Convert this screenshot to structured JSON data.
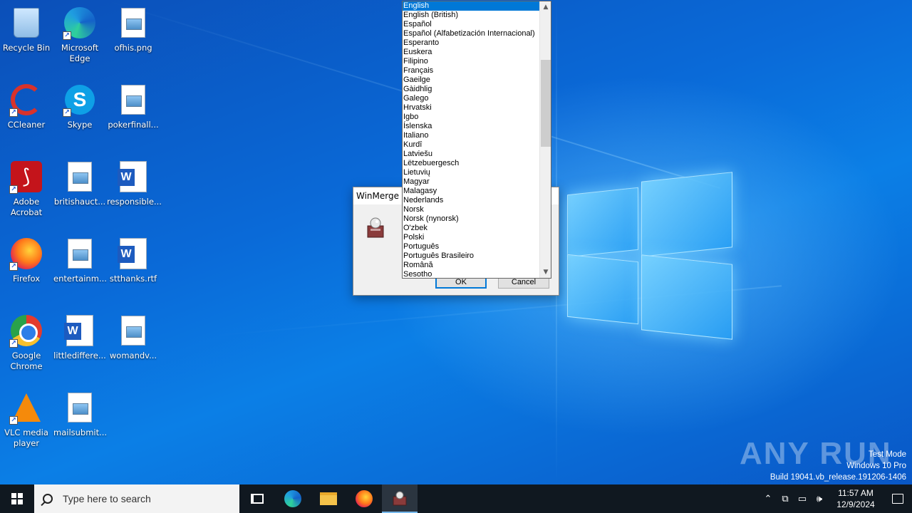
{
  "desktop": {
    "icons": [
      {
        "label": "Recycle Bin",
        "icon": "recycle-bin-icon"
      },
      {
        "label": "Microsoft Edge",
        "icon": "edge-icon"
      },
      {
        "label": "ofhis.png",
        "icon": "image-file-icon"
      },
      {
        "label": "CCleaner",
        "icon": "ccleaner-icon"
      },
      {
        "label": "Skype",
        "icon": "skype-icon"
      },
      {
        "label": "pokerfinall...",
        "icon": "image-file-icon"
      },
      {
        "label": "Adobe Acrobat",
        "icon": "acrobat-icon"
      },
      {
        "label": "britishauct...",
        "icon": "image-file-icon"
      },
      {
        "label": "responsible...",
        "icon": "word-file-icon"
      },
      {
        "label": "Firefox",
        "icon": "firefox-icon"
      },
      {
        "label": "entertainm...",
        "icon": "image-file-icon"
      },
      {
        "label": "stthanks.rtf",
        "icon": "word-file-icon"
      },
      {
        "label": "Google Chrome",
        "icon": "chrome-icon"
      },
      {
        "label": "littlediffere...",
        "icon": "word-file-icon"
      },
      {
        "label": "womandv...",
        "icon": "image-file-icon"
      },
      {
        "label": "VLC media player",
        "icon": "vlc-icon"
      },
      {
        "label": "mailsubmit...",
        "icon": "image-file-icon"
      }
    ]
  },
  "dialog": {
    "title": "WinMerge P",
    "ok_label": "OK",
    "cancel_label": "Cancel"
  },
  "language_list": {
    "selected": "English",
    "items": [
      "English",
      "English (British)",
      "Español",
      "Español (Alfabetización Internacional)",
      "Esperanto",
      "Euskera",
      "Filipino",
      "Français",
      "Gaeilge",
      "Gàidhlig",
      "Galego",
      "Hrvatski",
      "Igbo",
      "Íslenska",
      "Italiano",
      "Kurdî",
      "Latviešu",
      "Lëtzebuergesch",
      "Lietuvių",
      "Magyar",
      "Malagasy",
      "Nederlands",
      "Norsk",
      "Norsk (nynorsk)",
      "O'zbek",
      "Polski",
      "Português",
      "Português Brasileiro",
      "Română",
      "Sesotho"
    ]
  },
  "watermark": {
    "brand": "ANY RUN",
    "line1": "Test Mode",
    "line2": "Windows 10 Pro",
    "line3": "Build 19041.vb_release.191206-1406"
  },
  "taskbar": {
    "search_placeholder": "Type here to search",
    "time": "11:57 AM",
    "date": "12/9/2024"
  }
}
